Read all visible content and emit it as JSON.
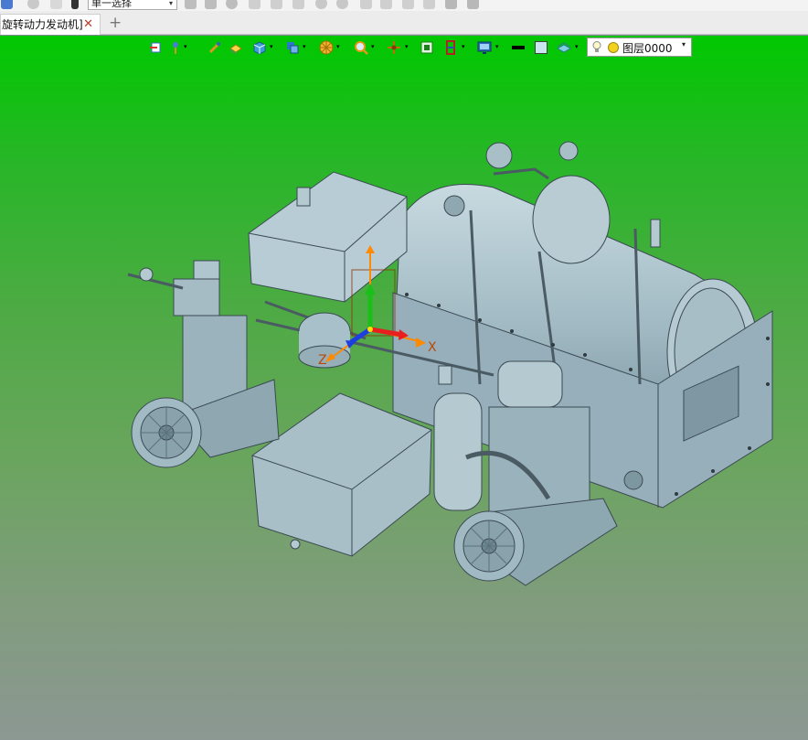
{
  "app": {
    "select_mode": "单一选择"
  },
  "tabs": [
    {
      "label": "旋转动力发动机]",
      "close": "✕"
    }
  ],
  "new_tab": "+",
  "view_toolbar": {
    "layer_label": "图层0000",
    "caret": "▾"
  },
  "viewport": {
    "axis_labels": {
      "x": "X",
      "z": "Z"
    },
    "background_top": "#00c800",
    "background_bottom": "#8c9893",
    "model_color": "#a9c2cc"
  },
  "icons": [
    "home-icon",
    "move-icon",
    "save-icon",
    "pick-icon",
    "undo-icon",
    "sketch-icon",
    "rotate-icon",
    "pin-icon",
    "snap-icon",
    "render-icon",
    "cube-icon",
    "layers-icon",
    "render-color-icon",
    "zoom-icon",
    "axis-icon",
    "fit-icon",
    "section-icon",
    "display-icon",
    "line-color-icon",
    "fill-color-icon",
    "visibility-icon",
    "bulb-icon"
  ]
}
